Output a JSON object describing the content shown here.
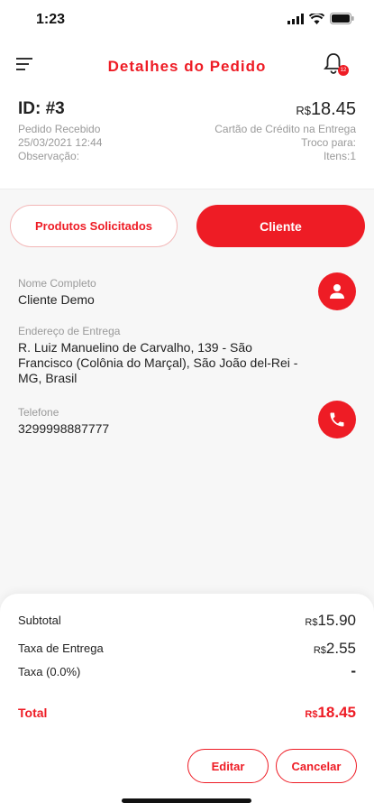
{
  "status": {
    "time": "1:23"
  },
  "header": {
    "title": "Detalhes do Pedido",
    "badge": "12"
  },
  "order": {
    "id": "ID: #3",
    "status_label": "Pedido Recebido",
    "date": "25/03/2021 12:44",
    "note_label": "Observação:",
    "currency": "R$",
    "total": "18.45",
    "payment": "Cartão de Crédito na Entrega",
    "change_label": "Troco para:",
    "items": "Itens:1"
  },
  "tabs": {
    "products": "Produtos Solicitados",
    "client": "Cliente"
  },
  "client": {
    "name_label": "Nome Completo",
    "name": "Cliente Demo",
    "address_label": "Endereço de Entrega",
    "address": "R. Luiz Manuelino de Carvalho, 139 - São Francisco (Colônia do Marçal), São João del-Rei - MG, Brasil",
    "phone_label": "Telefone",
    "phone": "3299998887777"
  },
  "summary": {
    "subtotal_label": "Subtotal",
    "subtotal_currency": "R$",
    "subtotal": "15.90",
    "delivery_label": "Taxa de Entrega",
    "delivery_currency": "R$",
    "delivery": "2.55",
    "tax_label": "Taxa (0.0%)",
    "tax": "-",
    "total_label": "Total",
    "total_currency": "R$",
    "total": "18.45"
  },
  "actions": {
    "edit": "Editar",
    "cancel": "Cancelar"
  },
  "colors": {
    "accent": "#ee1c25"
  }
}
